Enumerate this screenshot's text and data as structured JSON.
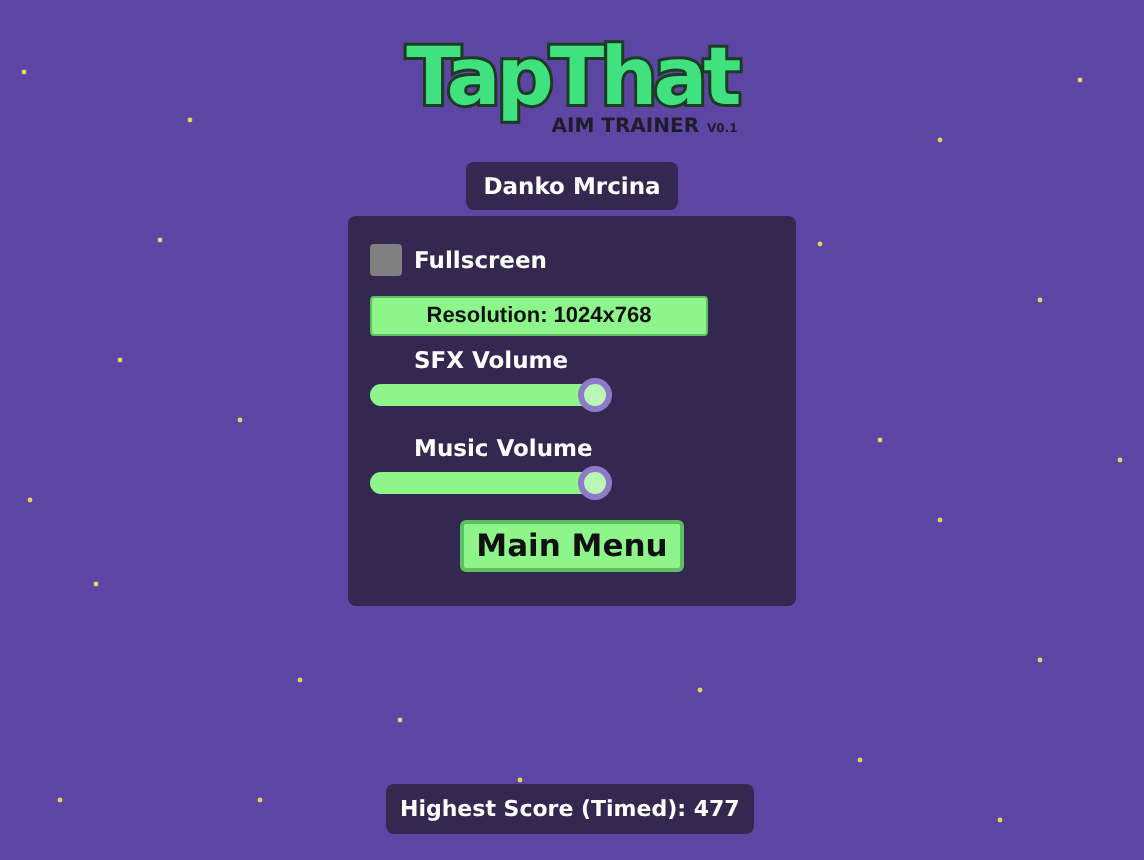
{
  "logo": {
    "title": "TapThat",
    "subtitle": "AIM TRAINER",
    "version": "V0.1"
  },
  "player_name": "Danko Mrcina",
  "settings": {
    "fullscreen": {
      "label": "Fullscreen",
      "checked": false
    },
    "resolution": "Resolution: 1024x768",
    "sliders": [
      {
        "label": "SFX Volume",
        "level": 1.0
      },
      {
        "label": "Music Volume",
        "level": 1.0
      }
    ],
    "main_menu_button": "Main Menu"
  },
  "highest_score": "Highest Score (Timed): 477"
}
